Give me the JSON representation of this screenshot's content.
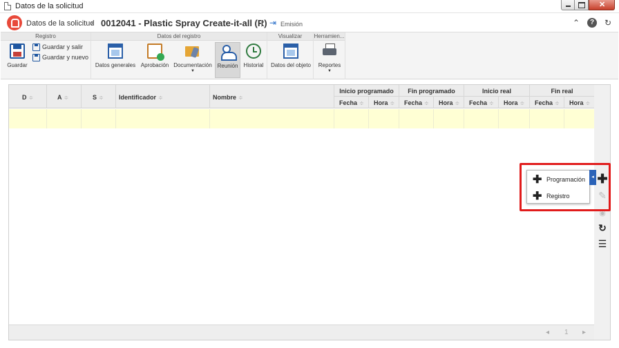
{
  "window": {
    "title": "Datos de la solicitud"
  },
  "header": {
    "breadcrumb_root": "Datos de la solicitud",
    "breadcrumb_sep": "›",
    "record_title": "0012041 - Plastic Spray Create-it-all (R)",
    "emission_label": "Emisión"
  },
  "toolbar": {
    "groups": {
      "registro": "Registro",
      "datos_registro": "Datos del registro",
      "visualizar": "Visualizar",
      "herramientas": "Herramien..."
    },
    "guardar": "Guardar",
    "guardar_salir": "Guardar y salir",
    "guardar_nuevo": "Guardar y nuevo",
    "datos_generales": "Datos generales",
    "aprobacion": "Aprobación",
    "documentacion": "Documentación",
    "reunion": "Reunión",
    "historial": "Historial",
    "datos_objeto": "Datos del objeto",
    "reportes": "Reportes"
  },
  "table": {
    "columns": {
      "d": "D",
      "a": "A",
      "s": "S",
      "identificador": "Identificador",
      "nombre": "Nombre",
      "inicio_programado": "Inicio programado",
      "fin_programado": "Fin programado",
      "inicio_real": "Inicio real",
      "fin_real": "Fin real",
      "fecha": "Fecha",
      "hora": "Hora"
    },
    "sort_glyph": "≑"
  },
  "pager": {
    "prev": "◂",
    "page": "1",
    "next": "▸"
  },
  "popup": {
    "items": [
      {
        "label": "Programación"
      },
      {
        "label": "Registro"
      }
    ]
  },
  "colors": {
    "accent": "#2b63b8",
    "highlight_border": "#e11b1b",
    "selected_row": "#ffffd4",
    "logo": "#e8493a"
  }
}
